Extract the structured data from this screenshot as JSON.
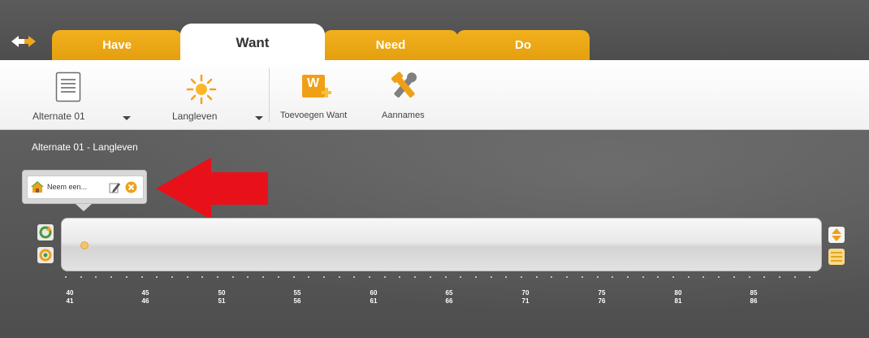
{
  "tabs": [
    {
      "label": "Have",
      "active": false
    },
    {
      "label": "Want",
      "active": true
    },
    {
      "label": "Need",
      "active": false
    },
    {
      "label": "Do",
      "active": false
    }
  ],
  "ribbon": {
    "alternate_select": "Alternate 01",
    "goal_select": "Langleven",
    "add_want_label": "Toevoegen Want",
    "add_want_icon_letter": "W",
    "assumptions_label": "Aannames"
  },
  "main": {
    "title": "Alternate 01 - Langleven",
    "event_card_label": "Neem een...",
    "timeline_marker_age": 41
  },
  "timeline": {
    "ages_top": [
      "40",
      "45",
      "50",
      "55",
      "60",
      "65",
      "70",
      "75",
      "80",
      "85"
    ],
    "ages_bottom": [
      "41",
      "46",
      "51",
      "56",
      "61",
      "66",
      "71",
      "76",
      "81",
      "86"
    ]
  },
  "colors": {
    "tab_orange": "#eea515",
    "annotation_red": "#e8111a",
    "background_gray": "#575757"
  }
}
